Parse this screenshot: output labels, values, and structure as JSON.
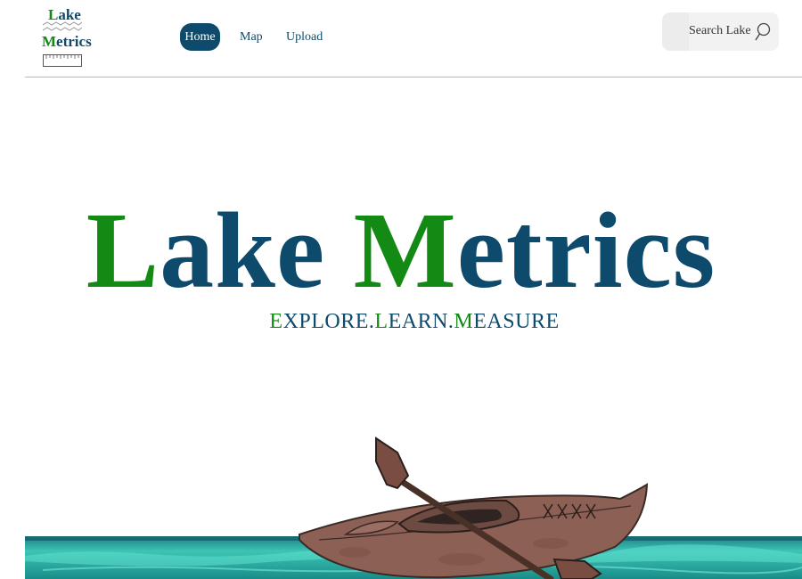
{
  "logo": {
    "line1_initial": "L",
    "line1_rest": "ake",
    "line2_initial": "M",
    "line2_rest": "etrics"
  },
  "nav": {
    "items": [
      {
        "label": "Home",
        "active": true
      },
      {
        "label": "Map"
      },
      {
        "label": "Upload"
      }
    ]
  },
  "search": {
    "placeholder": "Search Lake",
    "icon": "search-icon"
  },
  "hero": {
    "title_initial_1": "L",
    "title_rest_1": "ake",
    "title_initial_2": "M",
    "title_rest_2": "etrics",
    "tagline": [
      {
        "initial": "E",
        "rest": "XPLORE."
      },
      {
        "initial": "L",
        "rest": "EARN."
      },
      {
        "initial": "M",
        "rest": "EASURE"
      }
    ]
  },
  "colors": {
    "navy": "#0e4a6b",
    "green": "#138a13",
    "water": "#2fb3a6",
    "kayak": "#8c6055"
  }
}
